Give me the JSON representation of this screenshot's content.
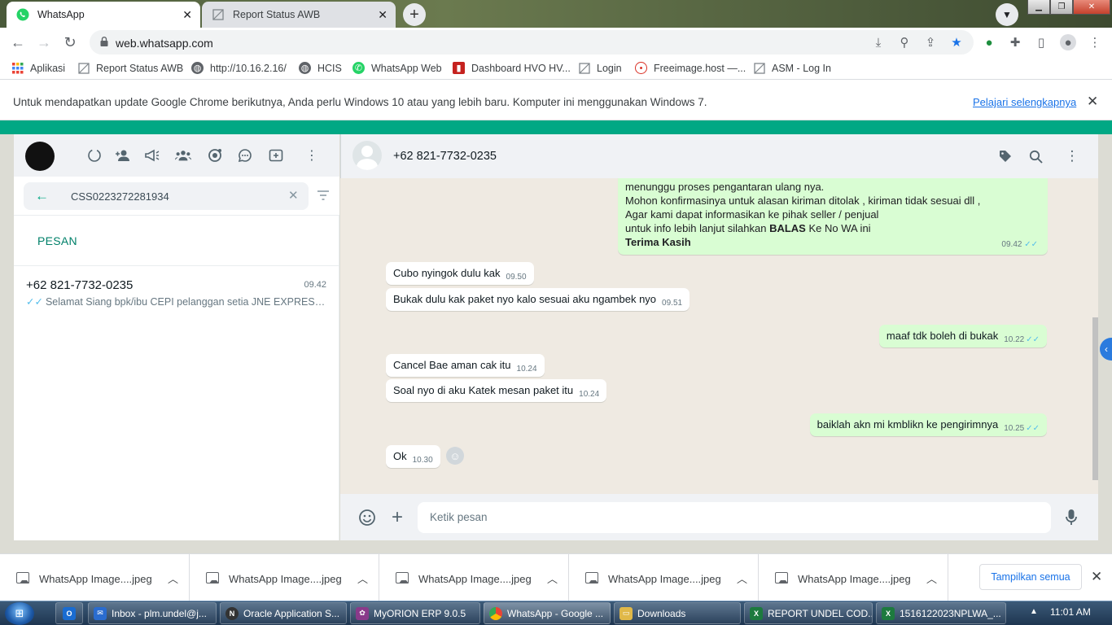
{
  "browser": {
    "tabs": [
      {
        "label": "WhatsApp",
        "active": true
      },
      {
        "label": "Report Status AWB",
        "active": false
      }
    ],
    "url": "web.whatsapp.com",
    "bookmarks": [
      {
        "label": "Aplikasi",
        "icon": "apps-grid-icon"
      },
      {
        "label": "Report Status AWB",
        "icon": "broken-page-icon"
      },
      {
        "label": "http://10.16.2.16/",
        "icon": "globe-icon"
      },
      {
        "label": "HCIS",
        "icon": "globe-icon"
      },
      {
        "label": "WhatsApp Web",
        "icon": "whatsapp-icon"
      },
      {
        "label": "Dashboard HVO HV...",
        "icon": "dashboard-icon"
      },
      {
        "label": "Login",
        "icon": "broken-page-icon"
      },
      {
        "label": "Freeimage.host —...",
        "icon": "freeimage-icon"
      },
      {
        "label": "ASM - Log In",
        "icon": "broken-page-icon"
      }
    ],
    "infobar": {
      "message": "Untuk mendapatkan update Google Chrome berikutnya, Anda perlu Windows 10 atau yang lebih baru. Komputer ini menggunakan Windows 7.",
      "link": "Pelajari selengkapnya"
    }
  },
  "left": {
    "search_value": "CSS0223272281934",
    "section_label": "PESAN",
    "chat": {
      "name": "+62 821-7732-0235",
      "time": "09.42",
      "preview": "Selamat Siang  bpk/ibu CEPI pelanggan setia JNE EXPRESS, T..."
    }
  },
  "chat": {
    "contact": "+62 821-7732-0235",
    "first_message": {
      "lines": [
        "menunggu proses pengantaran ulang nya.",
        "Mohon konfirmasinya untuk alasan kiriman ditolak , kiriman tidak sesuai dll ,",
        "Agar kami dapat informasikan ke pihak seller / penjual"
      ],
      "line4_pre": "untuk info lebih lanjut silahkan ",
      "line4_bold": "BALAS",
      "line4_post": " Ke No WA ini",
      "line5": "Terima Kasih",
      "time": "09.42"
    },
    "messages": [
      {
        "dir": "in",
        "text": "Cubo nyingok dulu kak",
        "time": "09.50"
      },
      {
        "dir": "in",
        "text": "Bukak dulu kak paket nyo kalo sesuai aku ngambek nyo",
        "time": "09.51"
      },
      {
        "dir": "out",
        "text": "maaf tdk boleh di bukak",
        "time": "10.22"
      },
      {
        "dir": "in",
        "text": "Cancel Bae aman cak itu",
        "time": "10.24"
      },
      {
        "dir": "in",
        "text": "Soal nyo di aku Katek mesan paket itu",
        "time": "10.24"
      },
      {
        "dir": "out",
        "text": "baiklah akn mi kmblikn ke pengirimnya",
        "time": "10.25"
      },
      {
        "dir": "in",
        "text": "Ok",
        "time": "10.30"
      }
    ],
    "composer_placeholder": "Ketik pesan"
  },
  "downloads": {
    "items": [
      "WhatsApp Image....jpeg",
      "WhatsApp Image....jpeg",
      "WhatsApp Image....jpeg",
      "WhatsApp Image....jpeg",
      "WhatsApp Image....jpeg"
    ],
    "show_all": "Tampilkan semua"
  },
  "taskbar": {
    "items": [
      {
        "label": "Inbox - plm.undel@j...",
        "color": "#2a6ccf"
      },
      {
        "label": "Oracle Application S...",
        "color": "#333"
      },
      {
        "label": "MyORION ERP 9.0.5",
        "color": "#8a3a8a"
      },
      {
        "label": "WhatsApp - Google ...",
        "color": "#e8a100"
      },
      {
        "label": "Downloads",
        "color": "#e0b848"
      },
      {
        "label": "REPORT UNDEL COD...",
        "color": "#1d7a3e"
      },
      {
        "label": "1516122023NPLWA_...",
        "color": "#1d7a3e"
      }
    ],
    "clock": "11:01 AM"
  },
  "colors": {
    "wa_green": "#00a884",
    "out_bubble": "#d9fdd3",
    "ticks": "#53bdeb"
  }
}
